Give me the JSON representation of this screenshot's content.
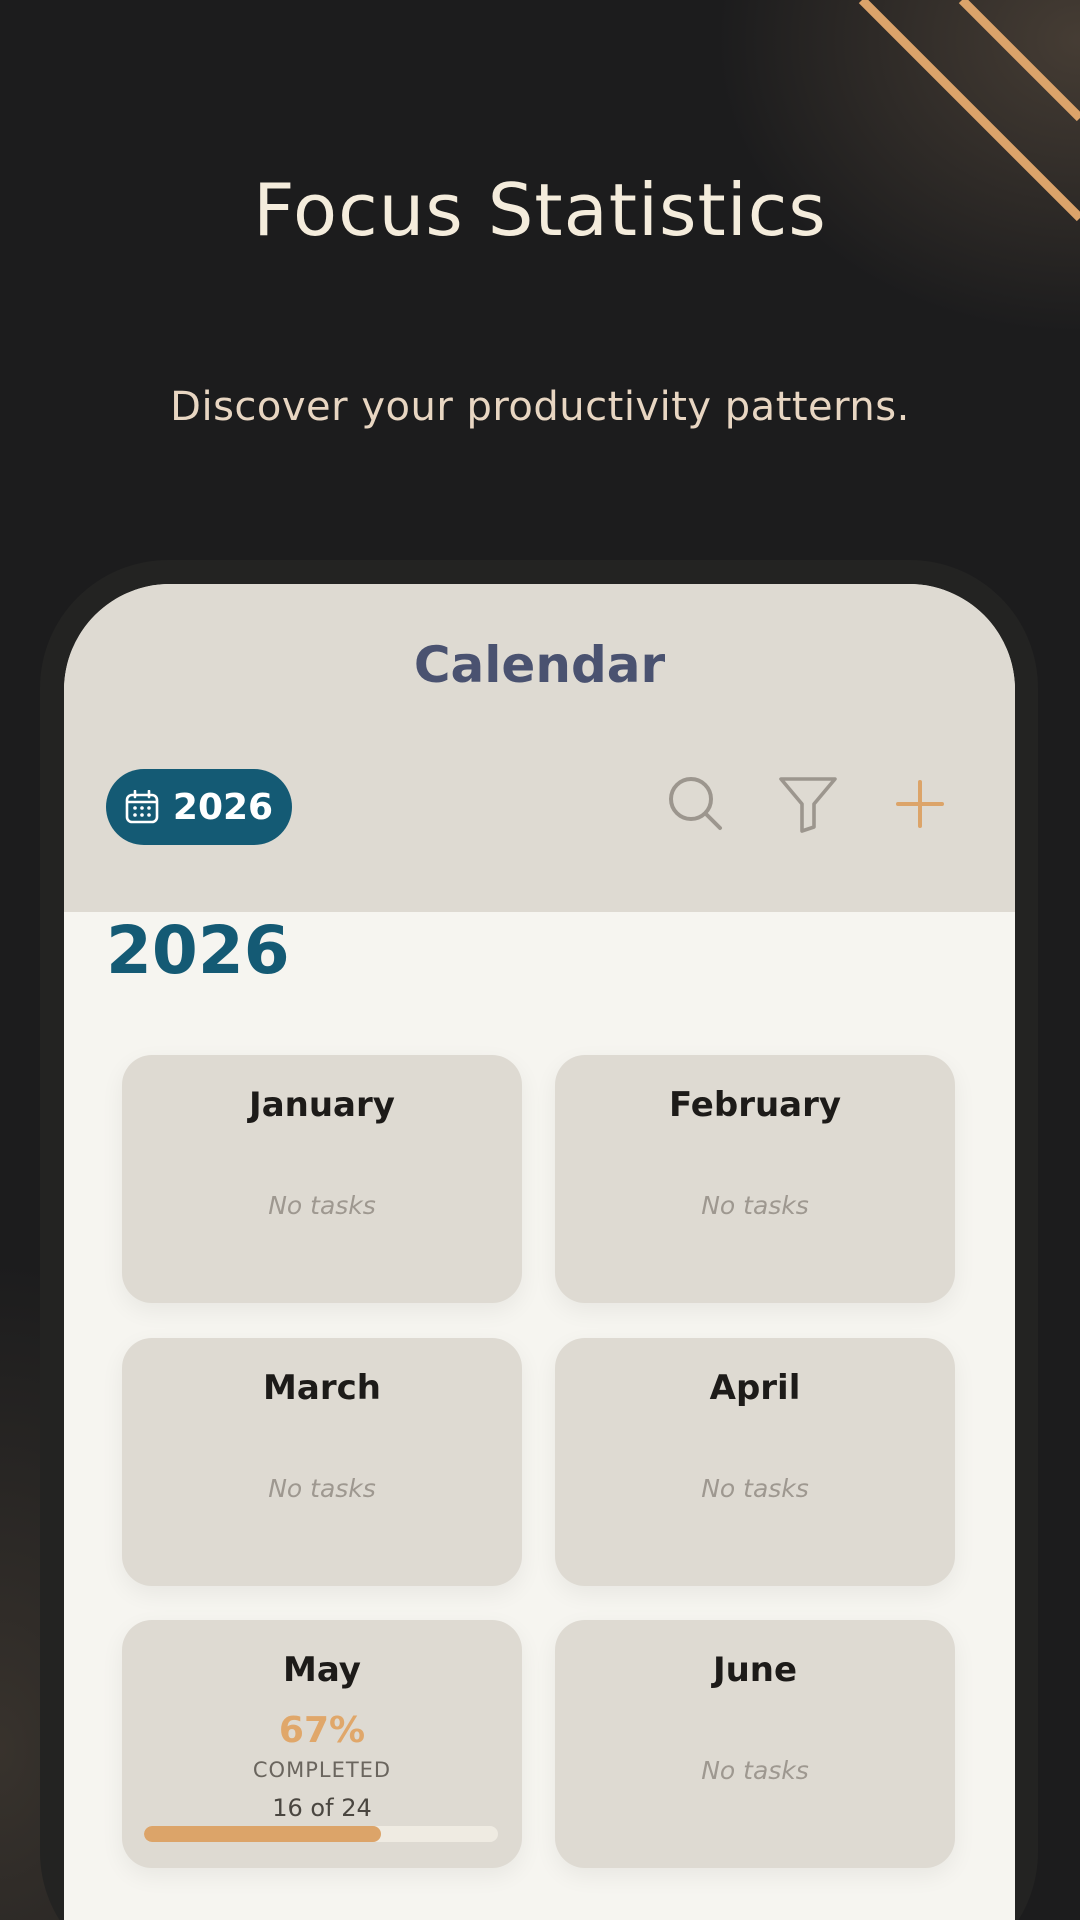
{
  "hero": {
    "title": "Focus Statistics",
    "subtitle": "Discover your productivity patterns."
  },
  "app": {
    "title": "Calendar",
    "year_chip_label": "2026",
    "toolbar": {
      "search_icon": "search-icon",
      "filter_icon": "filter-icon",
      "add_icon": "plus-icon"
    },
    "year_heading": "2026",
    "months": [
      {
        "name": "January",
        "empty_label": "No tasks"
      },
      {
        "name": "February",
        "empty_label": "No tasks"
      },
      {
        "name": "March",
        "empty_label": "No tasks"
      },
      {
        "name": "April",
        "empty_label": "No tasks"
      },
      {
        "name": "May",
        "percent_label": "67%",
        "status": "COMPLETED",
        "count": "16 of 24",
        "progress": 0.67
      },
      {
        "name": "June",
        "empty_label": "No tasks"
      }
    ]
  },
  "colors": {
    "background": "#1c1c1d",
    "hero_text": "#f4ecdc",
    "accent_blue": "#145a74",
    "accent_tan": "#dca469",
    "card_bg": "#dedad2",
    "app_title": "#4a5270"
  }
}
